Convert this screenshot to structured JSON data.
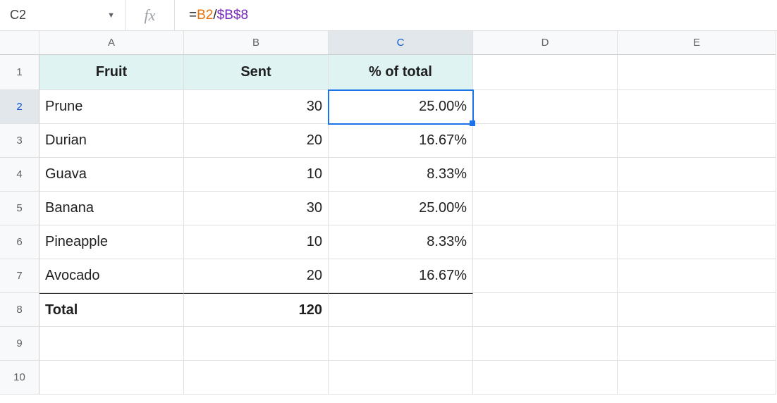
{
  "nameBox": "C2",
  "formula": {
    "eq": "=",
    "ref1": "B2",
    "op": "/",
    "ref2": "$B$8"
  },
  "fx": "fx",
  "columns": [
    "A",
    "B",
    "C",
    "D",
    "E"
  ],
  "rowNums": [
    "1",
    "2",
    "3",
    "4",
    "5",
    "6",
    "7",
    "8",
    "9",
    "10"
  ],
  "headers": {
    "A": "Fruit",
    "B": "Sent",
    "C": "% of total"
  },
  "rows": [
    {
      "A": "Prune",
      "B": "30",
      "C": "25.00%"
    },
    {
      "A": "Durian",
      "B": "20",
      "C": "16.67%"
    },
    {
      "A": "Guava",
      "B": "10",
      "C": "8.33%"
    },
    {
      "A": "Banana",
      "B": "30",
      "C": "25.00%"
    },
    {
      "A": "Pineapple",
      "B": "10",
      "C": "8.33%"
    },
    {
      "A": "Avocado",
      "B": "20",
      "C": "16.67%"
    }
  ],
  "total": {
    "label": "Total",
    "value": "120"
  },
  "selected": {
    "col": "C",
    "row": "2"
  }
}
